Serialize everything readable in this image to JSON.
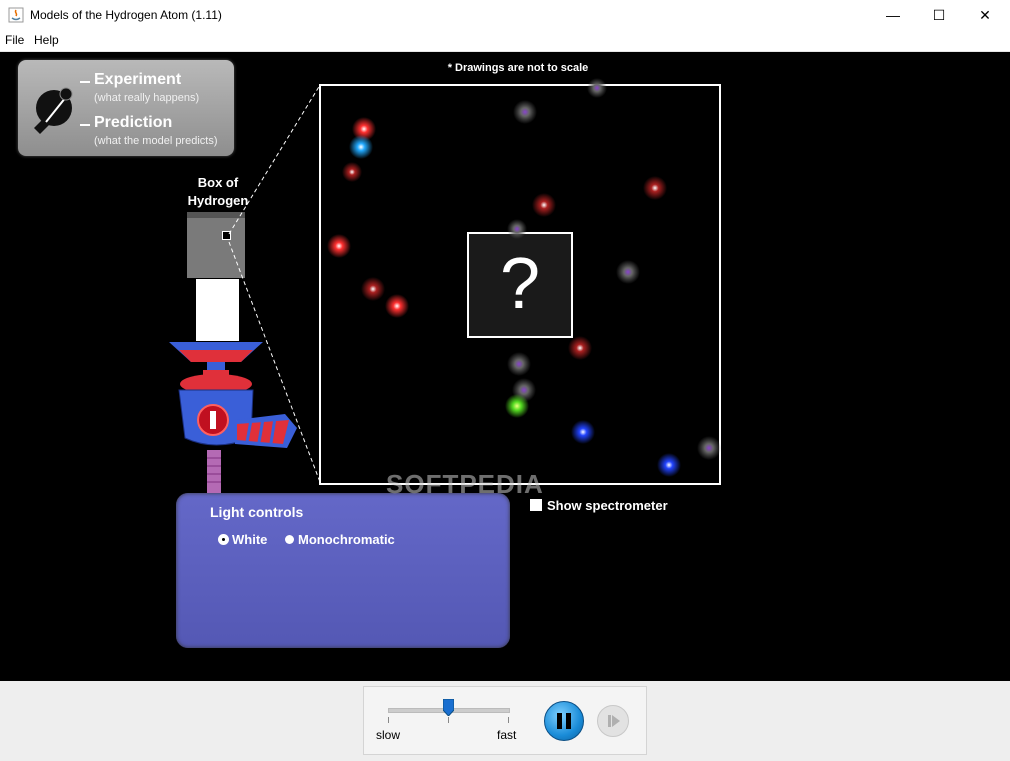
{
  "window": {
    "title": "Models of the Hydrogen Atom (1.11)",
    "minimize": "—",
    "maximize": "☐",
    "close": "✕"
  },
  "menu": {
    "items": [
      "File",
      "Help"
    ]
  },
  "mode": {
    "experiment_label": "Experiment",
    "experiment_sub": "(what really happens)",
    "prediction_label": "Prediction",
    "prediction_sub": "(what the model predicts)"
  },
  "box": {
    "label_line1": "Box of",
    "label_line2": "Hydrogen"
  },
  "view": {
    "note": "* Drawings are not to scale",
    "question": "?"
  },
  "spectrometer": {
    "label": "Show spectrometer",
    "checked": false
  },
  "light_controls": {
    "title": "Light controls",
    "options": [
      "White",
      "Monochromatic"
    ],
    "selected": "White"
  },
  "watermark": "SOFTPEDIA",
  "clock": {
    "slow_label": "slow",
    "fast_label": "fast",
    "speed_level": 0.5,
    "paused": false
  },
  "colors": {
    "canvas": "#000000",
    "light_panel": "#5c60c0",
    "gun_blue": "#3a5fd8",
    "gun_red": "#e0303a",
    "photon_red": "#ff3030",
    "photon_purple": "#8844cc",
    "photon_blue": "#2244ff",
    "photon_cyan": "#22aaff",
    "photon_green": "#55dd22"
  }
}
